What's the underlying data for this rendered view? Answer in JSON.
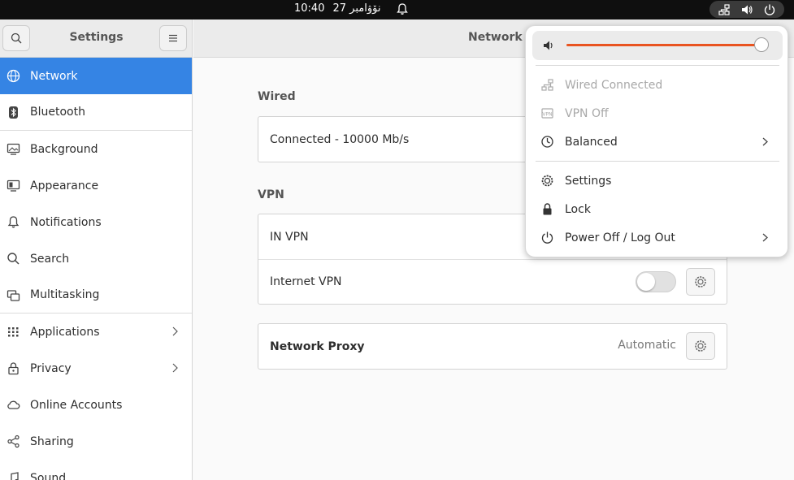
{
  "topbar": {
    "time": "10:40",
    "date": "27 نۆۋامبر",
    "icons": [
      "bell-icon",
      "network-icon",
      "volume-icon",
      "power-icon"
    ]
  },
  "window": {
    "sidebar_title": "Settings",
    "page_title": "Network"
  },
  "sidebar": {
    "items": [
      {
        "label": "Network",
        "icon": "network-icon",
        "active": true
      },
      {
        "label": "Bluetooth",
        "icon": "bluetooth-icon"
      },
      {
        "label": "Background",
        "icon": "background-icon"
      },
      {
        "label": "Appearance",
        "icon": "appearance-icon"
      },
      {
        "label": "Notifications",
        "icon": "bell-icon"
      },
      {
        "label": "Search",
        "icon": "search-icon"
      },
      {
        "label": "Multitasking",
        "icon": "multitasking-icon"
      },
      {
        "label": "Applications",
        "icon": "grid-icon",
        "chevron": true
      },
      {
        "label": "Privacy",
        "icon": "lock-icon",
        "chevron": true
      },
      {
        "label": "Online Accounts",
        "icon": "cloud-icon"
      },
      {
        "label": "Sharing",
        "icon": "share-icon"
      },
      {
        "label": "Sound",
        "icon": "music-icon"
      }
    ]
  },
  "wired": {
    "section_label": "Wired",
    "status": "Connected - 10000 Mb/s"
  },
  "vpn": {
    "section_label": "VPN",
    "items": [
      {
        "label": "IN VPN"
      },
      {
        "label": "Internet VPN",
        "enabled": false
      }
    ]
  },
  "proxy": {
    "label": "Network Proxy",
    "value": "Automatic"
  },
  "menu": {
    "volume_level": 0.97,
    "accent": "#e95420",
    "items": {
      "wired": "Wired Connected",
      "vpn": "VPN Off",
      "power_mode": "Balanced",
      "settings": "Settings",
      "lock": "Lock",
      "power": "Power Off / Log Out"
    }
  }
}
